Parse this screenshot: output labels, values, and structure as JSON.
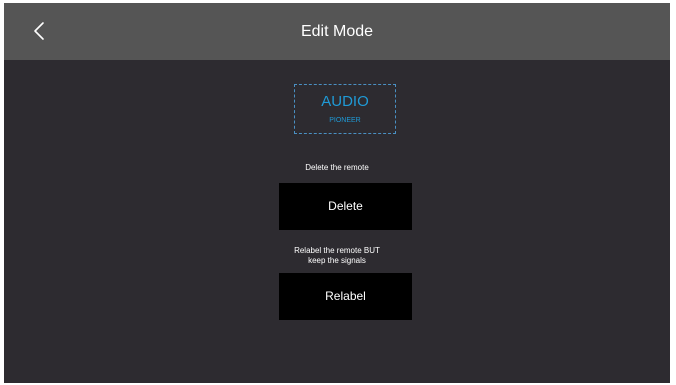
{
  "header": {
    "back_icon": "chevron-left-icon",
    "title": "Edit Mode"
  },
  "remote": {
    "name": "AUDIO",
    "brand": "PIONEER",
    "accent_color": "#1f9ad6"
  },
  "delete_section": {
    "caption": "Delete the remote",
    "button_label": "Delete"
  },
  "relabel_section": {
    "caption_line1": "Relabel the remote BUT",
    "caption_line2": "keep the signals",
    "button_label": "Relabel"
  },
  "colors": {
    "background": "#2d2b30",
    "header": "#555555",
    "button": "#000000"
  }
}
